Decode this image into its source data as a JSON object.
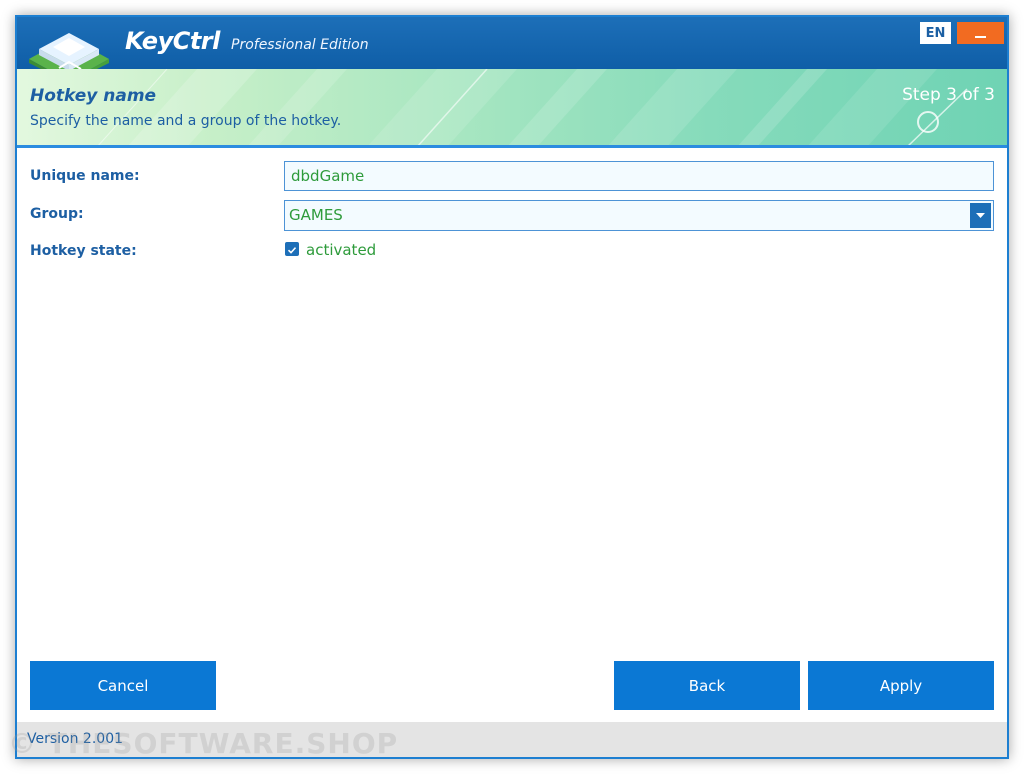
{
  "app": {
    "name": "KeyCtrl",
    "edition": "Professional Edition",
    "language_button": "EN"
  },
  "banner": {
    "title": "Hotkey name",
    "description": "Specify the name and a group of the hotkey.",
    "step": "Step 3 of 3"
  },
  "form": {
    "unique_name_label": "Unique name:",
    "unique_name_value": "dbdGame",
    "group_label": "Group:",
    "group_value": "GAMES",
    "hotkey_state_label": "Hotkey state:",
    "hotkey_state_checkbox_label": "activated"
  },
  "buttons": {
    "cancel": "Cancel",
    "back": "Back",
    "apply": "Apply"
  },
  "footer": {
    "version": "Version 2.001"
  },
  "watermark": "© THESOFTWARE.SHOP",
  "colors": {
    "title_bar": "#0f5ea7",
    "accent_orange": "#f26b21",
    "button_blue": "#0b78d4",
    "label_blue": "#1d5fa3",
    "value_green": "#2e9b3b"
  },
  "icons": {
    "logo": "keyboard-key-icon",
    "minimize": "minimize-icon",
    "dropdown": "chevron-down-icon",
    "checkbox": "checkmark-icon"
  }
}
